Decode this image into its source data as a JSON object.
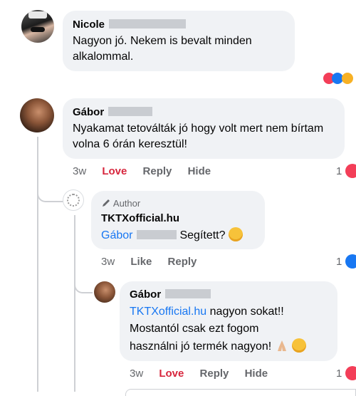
{
  "comments": [
    {
      "author": "Nicole",
      "text": "Nagyon jó. Nekem is bevalt minden alkalommal."
    },
    {
      "author": "Gábor",
      "text": "Nyakamat tetoválták jó hogy volt mert nem bírtam volna 6 órán keresztül!",
      "time": "3w",
      "love": "Love",
      "reply": "Reply",
      "hide": "Hide",
      "react_count": "1"
    },
    {
      "author_badge": "Author",
      "author": "TKTXofficial.hu",
      "mention": "Gábor",
      "text": "Segített?",
      "time": "3w",
      "like": "Like",
      "reply": "Reply",
      "react_count": "1"
    },
    {
      "author": "Gábor",
      "mention": "TKTXofficial.hu",
      "text_1": "nagyon sokat!!",
      "text_2": "Mostantól csak ezt fogom",
      "text_3": "használni jó termék nagyon!",
      "time": "3w",
      "love": "Love",
      "reply": "Reply",
      "hide": "Hide",
      "react_count": "1"
    }
  ],
  "colors": {
    "bubble": "#f0f2f5",
    "love": "#d7263d",
    "like": "#1877f2",
    "meta": "#65676b"
  }
}
